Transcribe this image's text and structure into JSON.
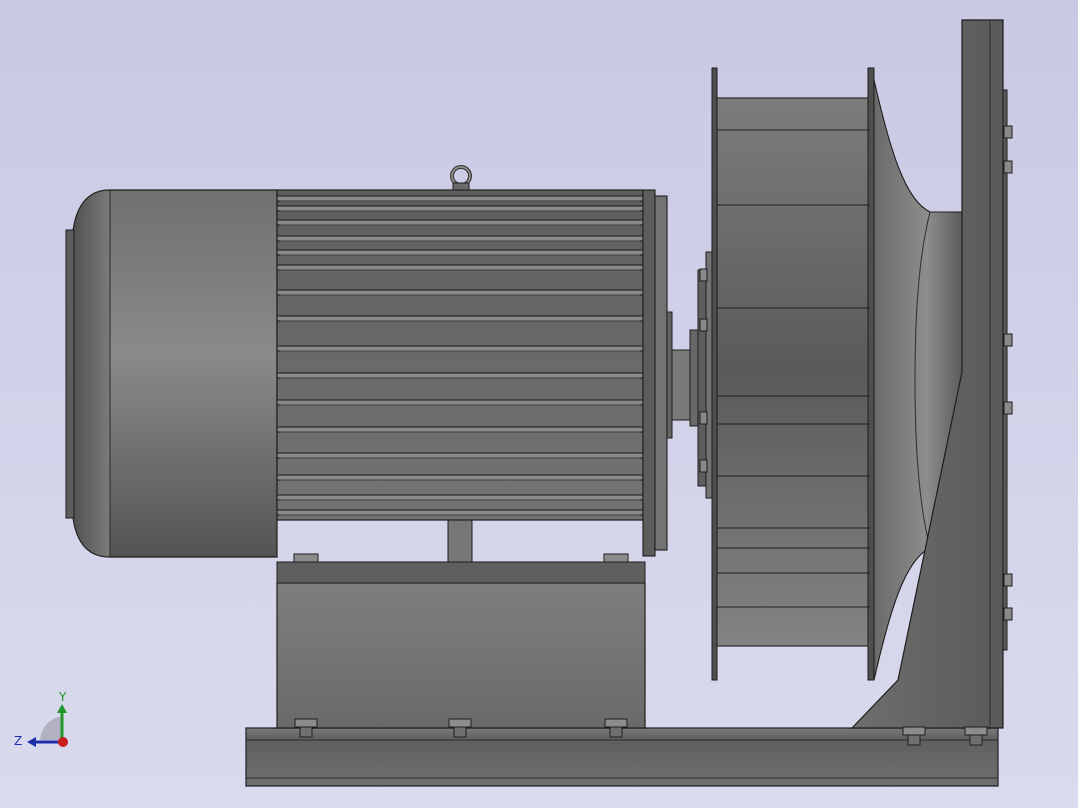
{
  "viewport": {
    "background_top": "#c9c9e4",
    "background_bottom": "#dadaee"
  },
  "model": {
    "components": [
      "motor-end-cap",
      "motor-finned-body",
      "lifting-eye",
      "motor-flange",
      "shaft-coupling",
      "fan-impeller",
      "inlet-cone",
      "fan-casing-plate",
      "motor-pedestal",
      "base-rail"
    ],
    "metal_color": "#6d6d6d",
    "edge_color": "#1e1e1e"
  },
  "triad": {
    "y_label": "Y",
    "z_label": "Z",
    "y_color": "#1f9a2a",
    "z_color": "#1b2ea8",
    "x_color": "#c81e1e"
  }
}
